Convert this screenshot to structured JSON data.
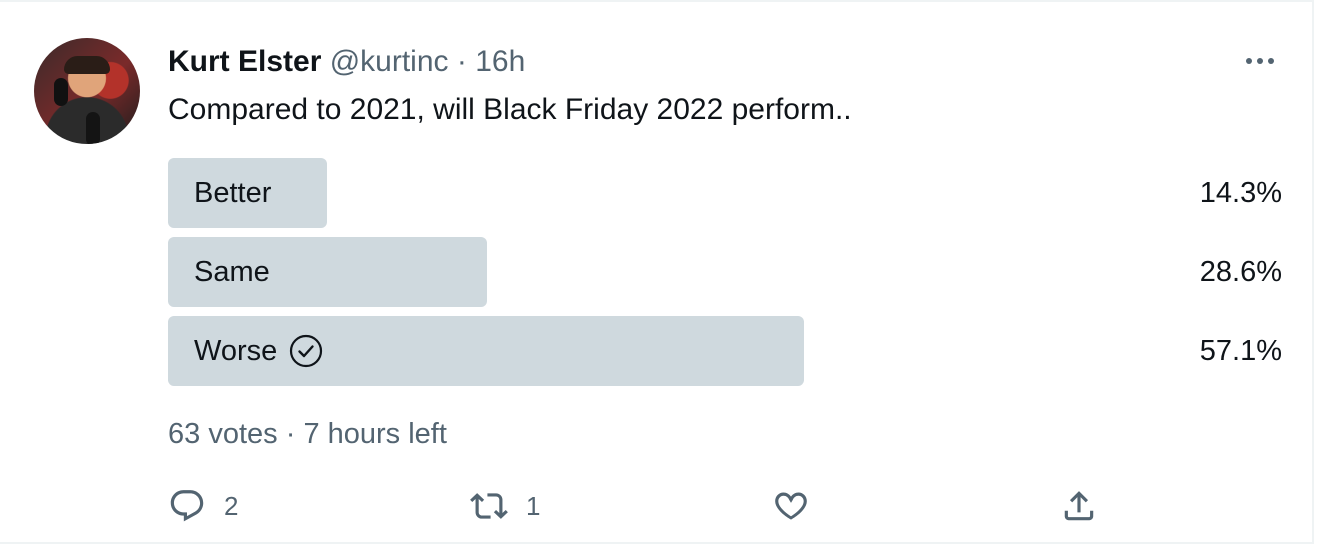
{
  "author": {
    "name": "Kurt Elster",
    "handle": "@kurtinc",
    "separator": "·",
    "time": "16h"
  },
  "tweet_text": "Compared to 2021, will Black Friday 2022 perform..",
  "poll": {
    "options": [
      {
        "label": "Better",
        "percent_text": "14.3%",
        "fraction": 0.143
      },
      {
        "label": "Same",
        "percent_text": "28.6%",
        "fraction": 0.286
      },
      {
        "label": "Worse",
        "percent_text": "57.1%",
        "fraction": 0.571,
        "winner": true
      }
    ],
    "votes_text": "63 votes",
    "separator": "·",
    "time_left": "7 hours left"
  },
  "actions": {
    "reply": {
      "icon": "reply-icon",
      "count": "2"
    },
    "retweet": {
      "icon": "retweet-icon",
      "count": "1"
    },
    "like": {
      "icon": "heart-icon",
      "count": ""
    },
    "share": {
      "icon": "share-icon",
      "count": ""
    }
  },
  "colors": {
    "text": "#0f1419",
    "secondary": "#536471",
    "bar": "#cfd9de",
    "border": "#eff3f4"
  }
}
